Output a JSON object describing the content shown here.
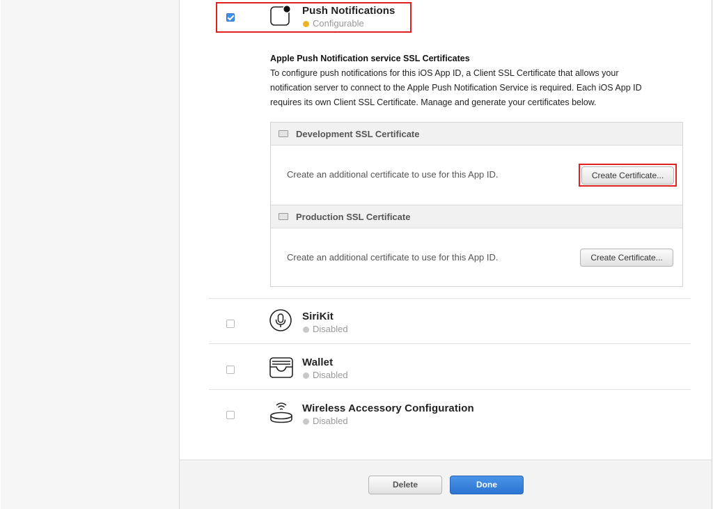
{
  "services": {
    "push": {
      "name": "Push Notifications",
      "status": "Configurable",
      "checked": true
    },
    "sirikit": {
      "name": "SiriKit",
      "status": "Disabled",
      "checked": false
    },
    "wallet": {
      "name": "Wallet",
      "status": "Disabled",
      "checked": false
    },
    "wireless": {
      "name": "Wireless Accessory Configuration",
      "status": "Disabled",
      "checked": false
    }
  },
  "push_config": {
    "title": "Apple Push Notification service SSL Certificates",
    "description": "To configure push notifications for this iOS App ID, a Client SSL Certificate that allows your notification server to connect to the Apple Push Notification Service is required. Each iOS App ID requires its own Client SSL Certificate. Manage and generate your certificates below.",
    "development": {
      "title": "Development SSL Certificate",
      "text": "Create an additional certificate to use for this App ID.",
      "button": "Create Certificate..."
    },
    "production": {
      "title": "Production SSL Certificate",
      "text": "Create an additional certificate to use for this App ID.",
      "button": "Create Certificate..."
    }
  },
  "footer": {
    "delete_label": "Delete",
    "done_label": "Done"
  },
  "colors": {
    "configurable": "#f0b323",
    "disabled": "#c8c8c8",
    "primary": "#2f7ad6",
    "highlight": "#e02020"
  }
}
